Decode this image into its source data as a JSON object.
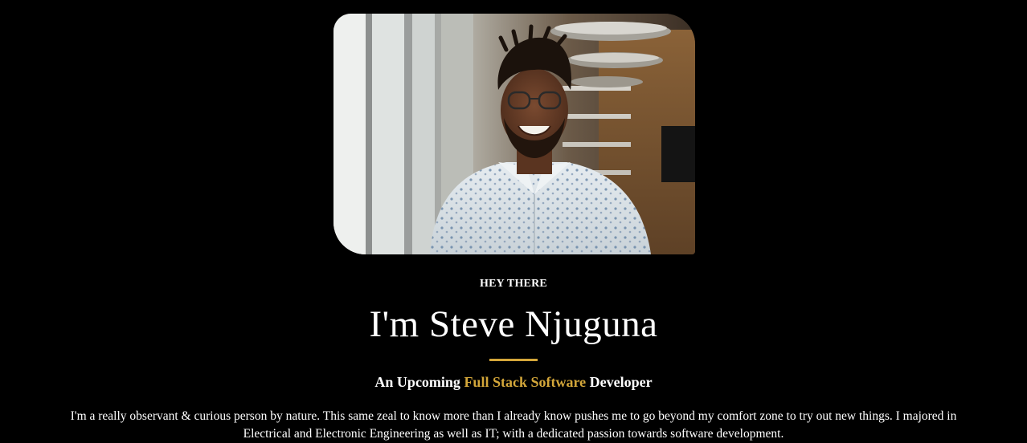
{
  "hero": {
    "photo_alt": "Portrait of a smiling man with glasses wearing a patterned shirt",
    "eyebrow": "HEY THERE",
    "name": "I'm Steve Njuguna",
    "tagline_prefix": "An Upcoming ",
    "tagline_highlight": "Full Stack Software",
    "tagline_suffix": " Developer",
    "bio": "I'm a really observant & curious person by nature. This same zeal to know more than I already know pushes me to go beyond my comfort zone to try out new things. I majored in Electrical and Electronic Engineering as well as IT; with a dedicated passion towards software development."
  },
  "colors": {
    "background": "#000000",
    "text": "#ffffff",
    "accent": "#d4a73a"
  }
}
